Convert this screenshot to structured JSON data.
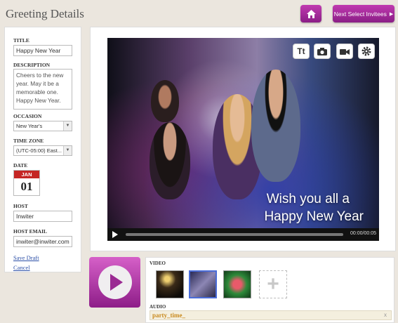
{
  "header": {
    "title": "Greeting Details",
    "next_label": "Next Select Invitees"
  },
  "form": {
    "title_label": "TITLE",
    "title_value": "Happy New Year",
    "description_label": "DESCRIPTION",
    "description_value": "Cheers to the new year. May it be a memorable one. Happy New Year.",
    "occasion_label": "OCCASION",
    "occasion_value": "New Year's",
    "timezone_label": "TIME ZONE",
    "timezone_value": "(UTC-05:00) East...",
    "date_label": "DATE",
    "date_month": "JAN",
    "date_day": "01",
    "host_label": "HOST",
    "host_value": "Inwiter",
    "host_email_label": "HOST EMAIL",
    "host_email_value": "inwiter@inwiter.com",
    "save_draft": "Save Draft",
    "cancel": "Cancel"
  },
  "video": {
    "overlay_line1": "Wish you all a",
    "overlay_line2": "Happy New  Year",
    "time": "00:00/00:05",
    "tools": [
      "text-icon",
      "camera-icon",
      "video-camera-icon",
      "gear-icon"
    ],
    "text_tool_label": "Tt"
  },
  "media": {
    "video_label": "VIDEO",
    "audio_label": "AUDIO",
    "audio_name": "party_time_",
    "remove": "x"
  },
  "colors": {
    "accent": "#a02a98",
    "link": "#2b4fa7",
    "audio": "#c98a1e",
    "calendar": "#c52624"
  }
}
